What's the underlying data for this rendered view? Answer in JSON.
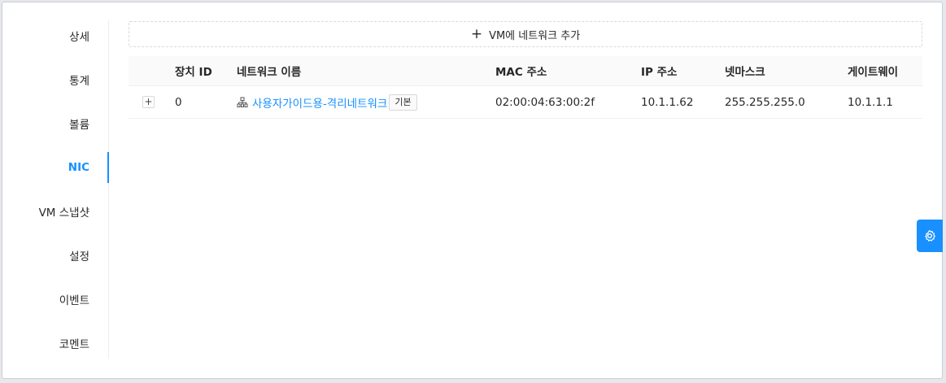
{
  "sidebar": {
    "items": [
      {
        "label": "상세"
      },
      {
        "label": "통계"
      },
      {
        "label": "볼륨"
      },
      {
        "label": "NIC"
      },
      {
        "label": "VM 스냅샷"
      },
      {
        "label": "설정"
      },
      {
        "label": "이벤트"
      },
      {
        "label": "코멘트"
      }
    ],
    "active_item": "NIC"
  },
  "add_network": {
    "label": "VM에 네트워크 추가",
    "icon": "plus-icon"
  },
  "table": {
    "columns": [
      "장치 ID",
      "네트워크 이름",
      "MAC 주소",
      "IP 주소",
      "넷마스크",
      "게이트웨이"
    ],
    "rows": [
      {
        "expand": "+",
        "device_id": "0",
        "network_name": "사용자가이드용-격리네트워크",
        "network_icon": "network-icon",
        "tag": "기본",
        "mac": "02:00:04:63:00:2f",
        "ip": "10.1.1.62",
        "netmask": "255.255.255.0",
        "gateway": "10.1.1.1"
      }
    ]
  },
  "floating": {
    "icon": "gear-icon"
  },
  "colors": {
    "accent": "#1890ff",
    "header_bg": "#fafafa",
    "border": "#f0f0f0"
  }
}
